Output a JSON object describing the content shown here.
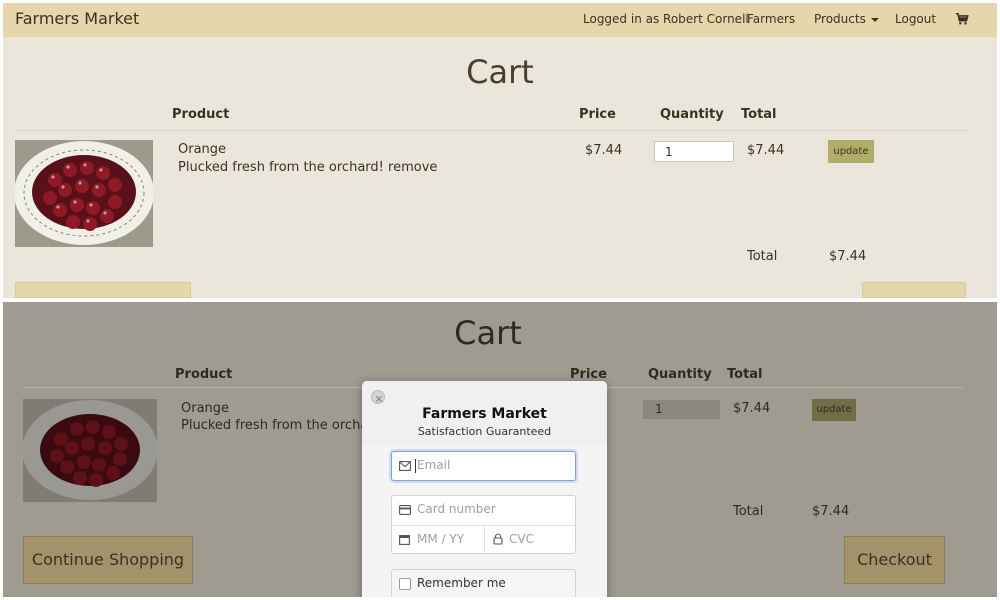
{
  "navbar": {
    "brand": "Farmers Market",
    "logged_in": "Logged in as Robert Cornell",
    "farmers": "Farmers",
    "products": "Products",
    "logout": "Logout"
  },
  "cart": {
    "title": "Cart",
    "headers": {
      "product": "Product",
      "price": "Price",
      "quantity": "Quantity",
      "total": "Total"
    },
    "item": {
      "name": "Orange",
      "description": "Plucked fresh from the orchard!",
      "remove": "remove",
      "price": "$7.44",
      "quantity": "1",
      "total": "$7.44",
      "update": "update"
    },
    "summary_label": "Total",
    "summary_value": "$7.44",
    "continue_button": "Continue Shopping",
    "checkout_button": "Checkout"
  },
  "modal": {
    "title": "Farmers Market",
    "subtitle": "Satisfaction Guaranteed",
    "email_placeholder": "Email",
    "card_placeholder": "Card number",
    "expiry_placeholder": "MM / YY",
    "cvc_placeholder": "CVC",
    "remember": "Remember me"
  },
  "colors": {
    "navbar_bg": "#e5d6ac",
    "page_bg": "#ebe6dc",
    "overlay_bg": "#9f9b90",
    "update_btn": "#b0ad6b",
    "focus_border": "#7ea3d8"
  }
}
